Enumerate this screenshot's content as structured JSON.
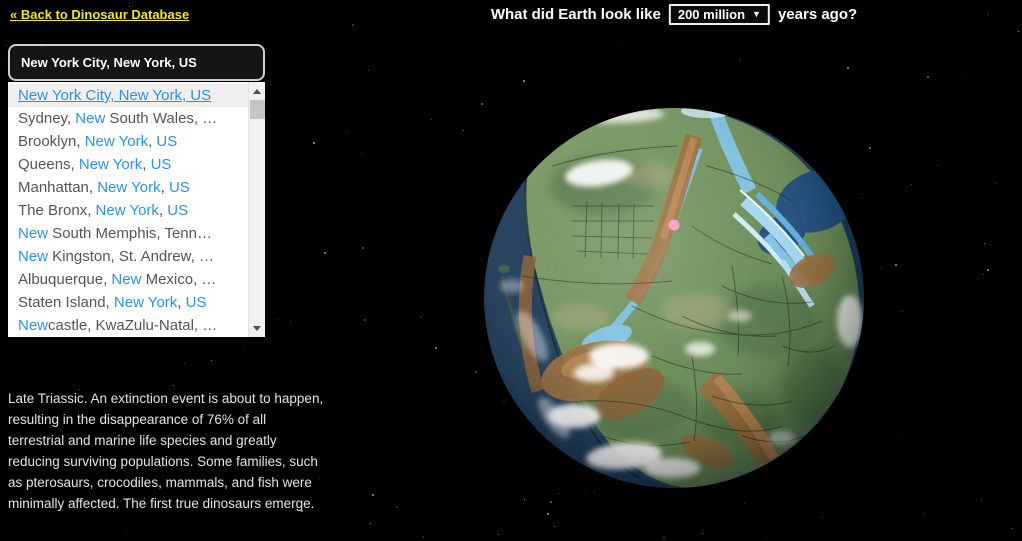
{
  "colors": {
    "background": "#000000",
    "link_yellow": "#f2ea00",
    "suggestion_blue": "#2b93dc",
    "suggestion_gray": "#555555",
    "marker_pink": "#f8a5c2"
  },
  "header": {
    "back_link": "« Back to Dinosaur Database",
    "question_prefix": "What did Earth look like",
    "question_suffix": "years ago?",
    "year_select_value": "200 million",
    "year_select_arrow": "▼"
  },
  "search": {
    "value": "New York City, New York, US"
  },
  "suggestions": {
    "items": [
      {
        "selected": true,
        "segments": [
          {
            "t": "New York City, New York, US",
            "hl": true
          }
        ]
      },
      {
        "selected": false,
        "segments": [
          {
            "t": "Sydney, ",
            "hl": false
          },
          {
            "t": "New",
            "hl": true
          },
          {
            "t": " South Wales, …",
            "hl": false
          }
        ]
      },
      {
        "selected": false,
        "segments": [
          {
            "t": "Brooklyn, ",
            "hl": false
          },
          {
            "t": "New York",
            "hl": true
          },
          {
            "t": ", ",
            "hl": false
          },
          {
            "t": "US",
            "hl": true
          }
        ]
      },
      {
        "selected": false,
        "segments": [
          {
            "t": "Queens, ",
            "hl": false
          },
          {
            "t": "New York",
            "hl": true
          },
          {
            "t": ", ",
            "hl": false
          },
          {
            "t": "US",
            "hl": true
          }
        ]
      },
      {
        "selected": false,
        "segments": [
          {
            "t": "Manhattan, ",
            "hl": false
          },
          {
            "t": "New York",
            "hl": true
          },
          {
            "t": ", ",
            "hl": false
          },
          {
            "t": "US",
            "hl": true
          }
        ]
      },
      {
        "selected": false,
        "segments": [
          {
            "t": "The Bronx, ",
            "hl": false
          },
          {
            "t": "New York",
            "hl": true
          },
          {
            "t": ", ",
            "hl": false
          },
          {
            "t": "US",
            "hl": true
          }
        ]
      },
      {
        "selected": false,
        "segments": [
          {
            "t": "New",
            "hl": true
          },
          {
            "t": " South Memphis, Tenn…",
            "hl": false
          }
        ]
      },
      {
        "selected": false,
        "segments": [
          {
            "t": "New",
            "hl": true
          },
          {
            "t": " Kingston, St. Andrew, …",
            "hl": false
          }
        ]
      },
      {
        "selected": false,
        "segments": [
          {
            "t": "Albuquerque, ",
            "hl": false
          },
          {
            "t": "New",
            "hl": true
          },
          {
            "t": " Mexico, …",
            "hl": false
          }
        ]
      },
      {
        "selected": false,
        "segments": [
          {
            "t": "Staten Island, ",
            "hl": false
          },
          {
            "t": "New York",
            "hl": true
          },
          {
            "t": ", ",
            "hl": false
          },
          {
            "t": "US",
            "hl": true
          }
        ]
      },
      {
        "selected": false,
        "segments": [
          {
            "t": "New",
            "hl": true
          },
          {
            "t": "castle, KwaZulu-Natal, …",
            "hl": false
          }
        ]
      }
    ]
  },
  "description": {
    "text": "Late Triassic. An extinction event is about to happen, resulting in the disappearance of 76% of all terrestrial and marine life species and greatly reducing surviving populations. Some families, such as pterosaurs, crocodiles, mammals, and fish were minimally affected. The first true dinosaurs emerge."
  }
}
